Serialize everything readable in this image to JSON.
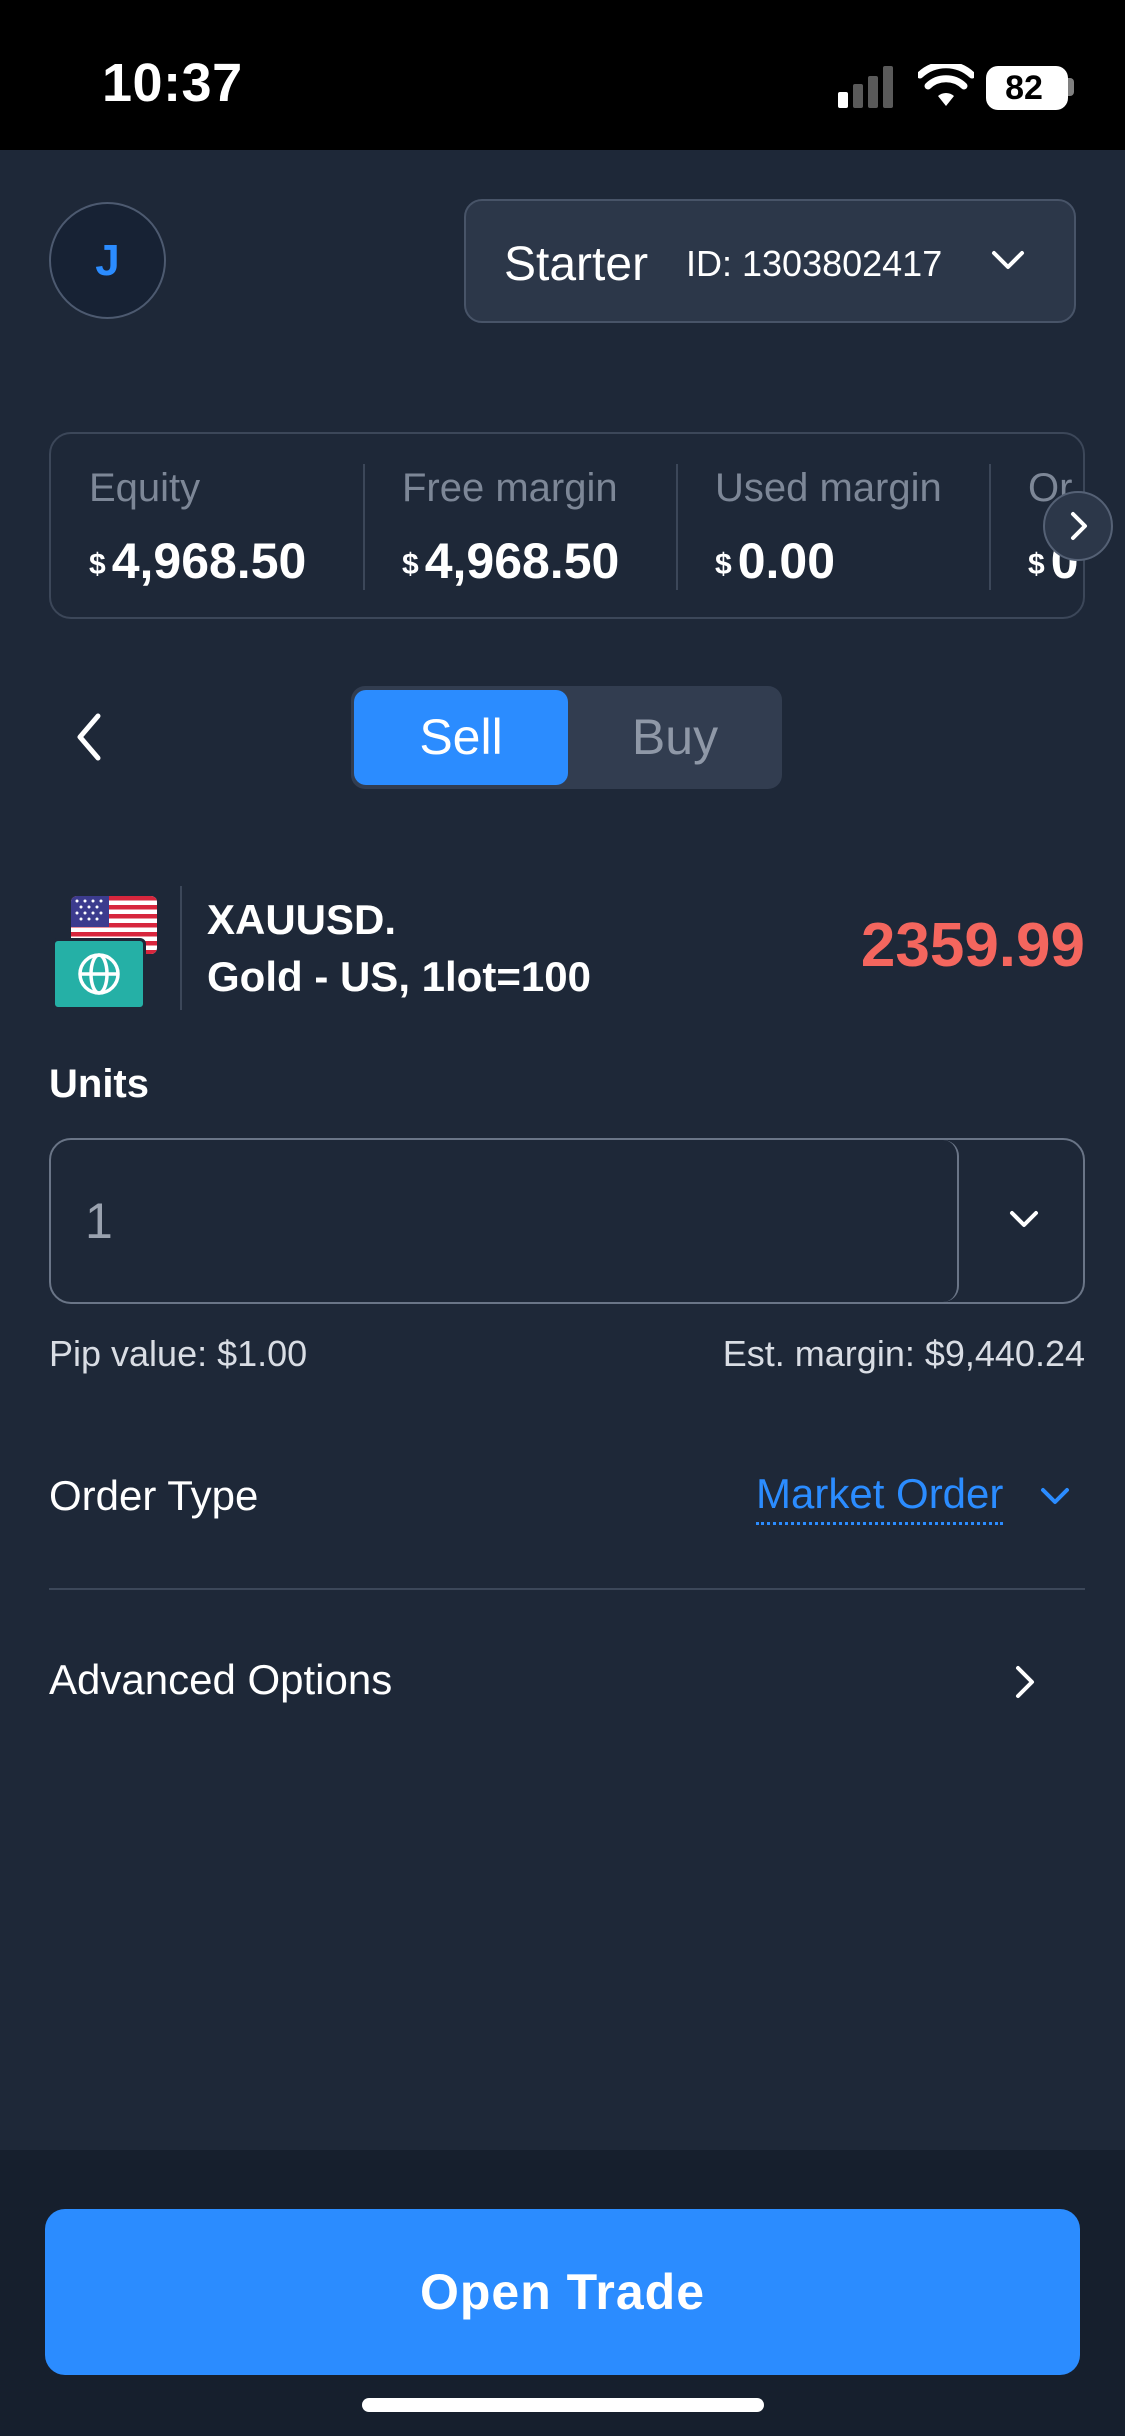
{
  "status_bar": {
    "time": "10:37",
    "battery": "82"
  },
  "header": {
    "avatar_initial": "J",
    "account_type": "Starter",
    "account_id": "ID: 1303802417"
  },
  "metrics": [
    {
      "label": "Equity",
      "currency": "$",
      "value": "4,968.50"
    },
    {
      "label": "Free margin",
      "currency": "$",
      "value": "4,968.50"
    },
    {
      "label": "Used margin",
      "currency": "$",
      "value": "0.00"
    },
    {
      "label": "Or",
      "currency": "$",
      "value": "0"
    }
  ],
  "trade_side": {
    "sell_label": "Sell",
    "buy_label": "Buy",
    "selected": "Sell"
  },
  "instrument": {
    "symbol": "XAUUSD.",
    "description": "Gold - US, 1lot=100",
    "price": "2359.99"
  },
  "units": {
    "label": "Units",
    "value": "1"
  },
  "info": {
    "pip_value": "Pip value: $1.00",
    "est_margin": "Est. margin: $9,440.24"
  },
  "order_type": {
    "label": "Order Type",
    "value": "Market Order"
  },
  "advanced": {
    "label": "Advanced Options"
  },
  "footer": {
    "open_trade_label": "Open Trade"
  },
  "colors": {
    "accent": "#2b8cff",
    "price_sell": "#f4665e",
    "background": "#1e2838",
    "badge": "#25b0a6"
  }
}
